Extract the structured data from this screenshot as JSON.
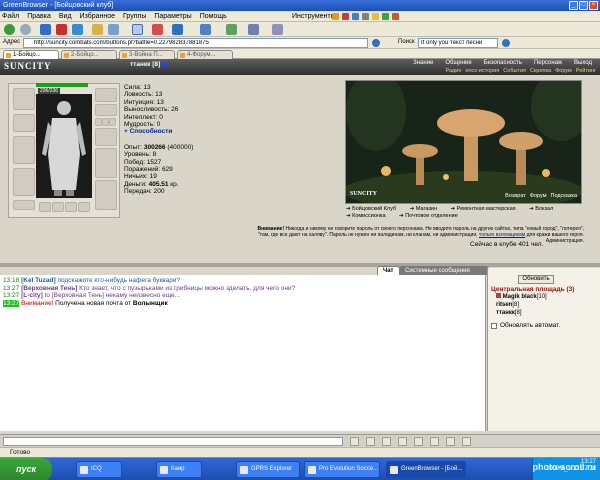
{
  "window": {
    "title": "GreenBrowser - [Бойцовский клуб]"
  },
  "menu": {
    "items": [
      "Файл",
      "Правка",
      "Вид",
      "Избранное",
      "Группы",
      "Параметры",
      "Помощь"
    ],
    "tools": "Инструменты"
  },
  "address": {
    "label": "Адрес",
    "url": "http://suncity.combats.com/buttons.pl?battle=0.227982837881875"
  },
  "search": {
    "label": "Поиск",
    "placeholder": "If only you текст песни"
  },
  "tabs": [
    {
      "label": "1-Бойцо..."
    },
    {
      "label": "2-Бойцо..."
    },
    {
      "label": "3-Война П..."
    },
    {
      "label": "4-Форум..."
    }
  ],
  "site": {
    "logo": "SUNCITY",
    "nav": [
      "Знание",
      "Общение",
      "Безопасность",
      "Персонаж",
      "Выход"
    ],
    "subnav": [
      "Радио",
      "encs-история",
      "События",
      "Скрепка",
      "Форум",
      "Рейтинг"
    ]
  },
  "character": {
    "name": "ттанкк",
    "level": "[8]",
    "hp": "236/236",
    "stats": {
      "strength": "Сила: 13",
      "agility": "Ловкость: 13",
      "intuition": "Интуиция: 13",
      "endurance": "Выносливость: 26",
      "intellect": "Интеллект: 0",
      "wisdom": "Мудрость: 0",
      "abilities_link": "+ Способности"
    },
    "info": {
      "exp": "300266",
      "exp_next": "(400000)",
      "level": "Уровень: 8",
      "wins": "Побед: 1527",
      "losses": "Поражений: 629",
      "draws": "Ничьих: 19",
      "money": "405.51",
      "transfers": "Передач: 200"
    }
  },
  "scene": {
    "label": "SUNCITY",
    "links": [
      "Возврат",
      "Форум",
      "Подсказка"
    ]
  },
  "scene_menu": [
    "Бойцовский Клуб",
    "Магазин",
    "Ремонтная мастерская",
    "Вокзал",
    "Комиссионка",
    "Почтовое отделение"
  ],
  "notice": {
    "title": "Внимание!",
    "line1": "Никогда и никому не говорите пароль от своего персонажа. Не вводите пароль на других сайтах, типа \"новый город\", \"лотерея\",",
    "line2": "\"там, где все дают на халяву\". Пароль не нужен ни паладинам, ни кланам, ни администрации,",
    "link": "только взломщикам",
    "line2b": "для кражи вашего героя.",
    "line3": "Администрация.",
    "online": "Сейчас в клубе 401 чел."
  },
  "chat_tabs": {
    "chat": "Чат",
    "system": "Системные сообщения"
  },
  "chat": [
    {
      "time": "13:18",
      "user": "[Kel Tuzad]",
      "text": " подскажите кто-нибудь нафега буквари?"
    },
    {
      "time": "13:27",
      "user": "[Верховная Тень]",
      "text": " Кто знает, что с пузырьками из грибницы можно зделать, для чего они?"
    },
    {
      "time": "13:27",
      "user": "[L-city]",
      "text": " to [Верховная Тень] некаму неизвесно еще..."
    },
    {
      "time": "13:27",
      "warn": "Внимание!",
      "text": " Получена новая почта от ",
      "from": "Волынщик"
    }
  ],
  "side": {
    "refresh": "Обновить",
    "room": "Центральная площадь (3)",
    "users": [
      {
        "name": "Magik black",
        "level": "[10]"
      },
      {
        "name": "ritsen",
        "level": "[8]"
      },
      {
        "name": "ттанкк",
        "level": "[8]"
      }
    ],
    "autorefresh": "Обновлять автомат."
  },
  "status": {
    "text": "Готово"
  },
  "taskbar": {
    "start": "пуск",
    "items": [
      "ICQ",
      "Каир",
      "GPRS Explorer",
      "Pro Evolution Socce...",
      "GreenBrowser - [Бой..."
    ],
    "clock": "13:27",
    "speed": "1002M_3 13:27:36"
  },
  "watermark": "photo-scroll.ru"
}
